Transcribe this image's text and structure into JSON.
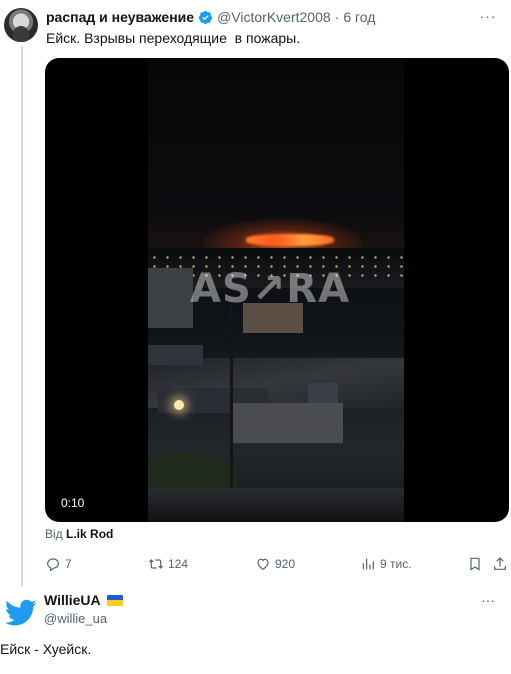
{
  "tweet1": {
    "author_name": "распад и неуважение",
    "handle": "@VictorKvert2008",
    "separator": "·",
    "time": "6 год",
    "more": "···",
    "text": "Ейск. Взрывы переходящие  в пожары.",
    "media": {
      "watermark": "AS↗RA",
      "duration": "0:10"
    },
    "source_prefix": "Від",
    "source_name": "L.ik Rod",
    "actions": {
      "replies": "7",
      "retweets": "124",
      "likes": "920",
      "views": "9 тис."
    }
  },
  "tweet2": {
    "author_name": "WillieUA",
    "handle": "@willie_ua",
    "more": "···",
    "text": "Ейск - Хуейск.",
    "flag_colors": [
      "#1f5bd6",
      "#f7d117"
    ]
  },
  "colors": {
    "twitter_blue": "#1d9bf0",
    "muted": "#536471"
  }
}
